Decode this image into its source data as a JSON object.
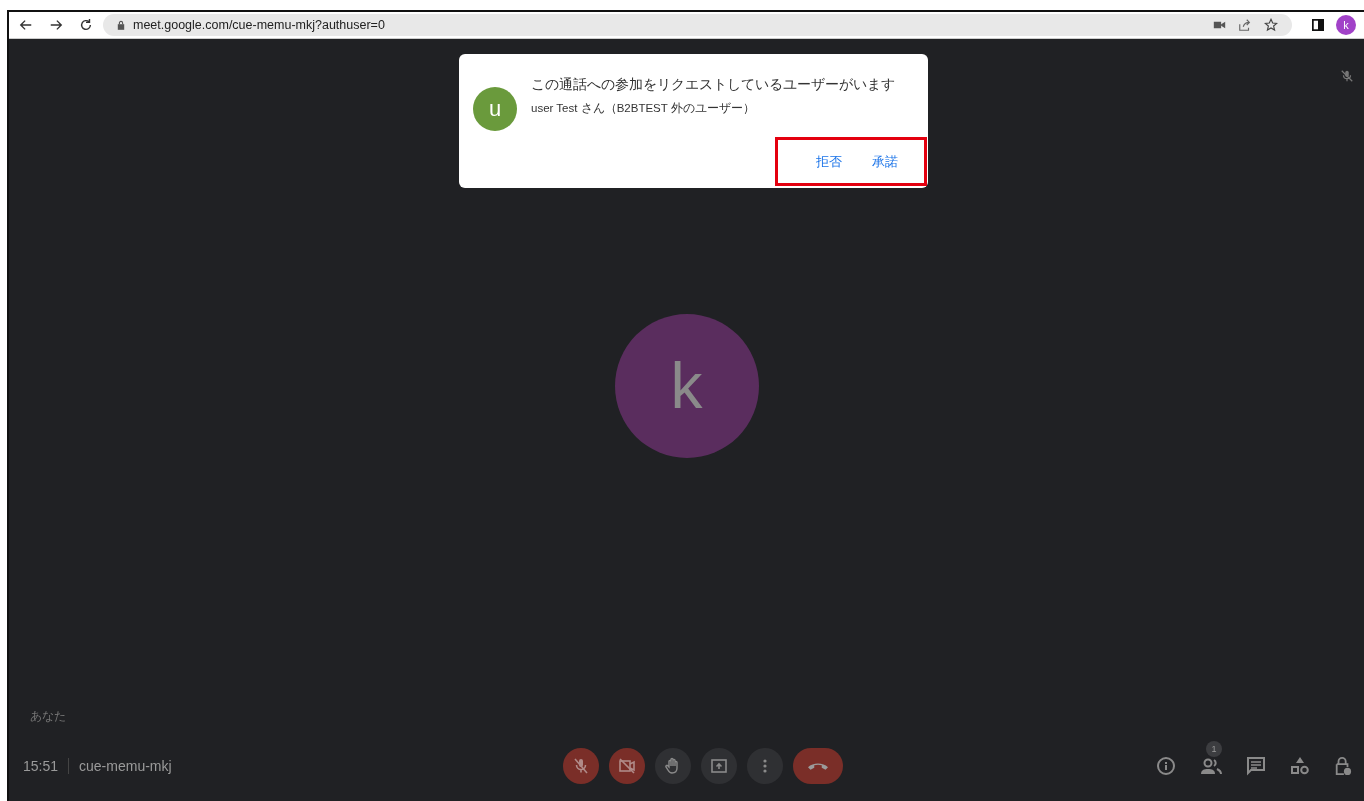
{
  "browser": {
    "url": "meet.google.com/cue-memu-mkj?authuser=0",
    "profile_initial": "k"
  },
  "request_dialog": {
    "avatar_initial": "u",
    "message": "この通話への参加をリクエストしているユーザーがいます",
    "detail": "user Test さん（B2BTEST 外のユーザー）",
    "buttons": [
      "拒否",
      "承諾"
    ],
    "highlighted": true
  },
  "stage": {
    "avatar_initial": "k",
    "self_label": "あなた",
    "muted": true
  },
  "bottom_bar": {
    "time": "15:51",
    "meeting_code": "cue-memu-mkj",
    "controls": [
      {
        "kind": "mic",
        "off": true
      },
      {
        "kind": "camera",
        "off": true
      },
      {
        "kind": "hand",
        "off": false
      },
      {
        "kind": "present",
        "off": false
      },
      {
        "kind": "more",
        "off": false
      },
      {
        "kind": "end"
      }
    ],
    "people_count": "1"
  }
}
